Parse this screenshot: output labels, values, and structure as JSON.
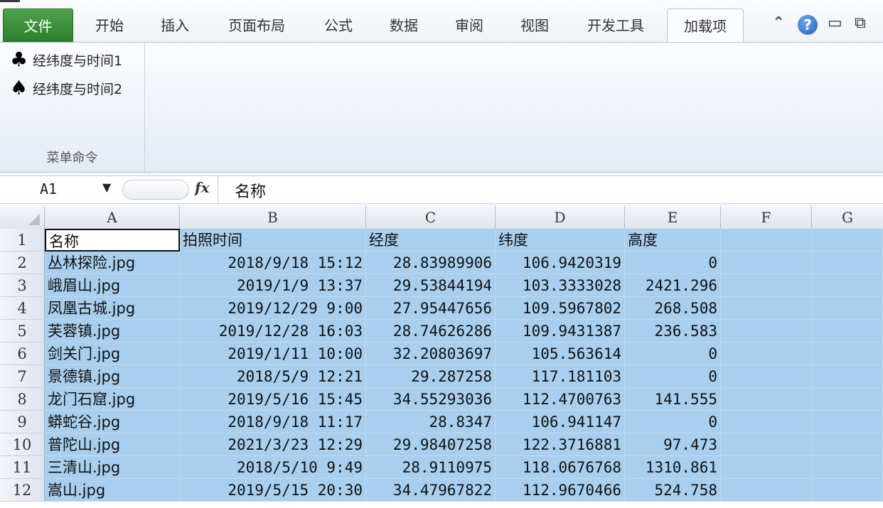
{
  "ribbon": {
    "tabs": [
      "文件",
      "开始",
      "插入",
      "页面布局",
      "公式",
      "数据",
      "审阅",
      "视图",
      "开发工具",
      "加载项"
    ],
    "active_tab": "加载项",
    "window_controls": {
      "collapse": "⌃",
      "help": "?",
      "minimize": "▭",
      "restore": "⧉"
    },
    "menu_group": {
      "items": [
        {
          "icon": "club-icon",
          "glyph": "♣",
          "label": "经纬度与时间1"
        },
        {
          "icon": "spade-icon",
          "glyph": "♠",
          "label": "经纬度与时间2"
        }
      ],
      "label": "菜单命令"
    }
  },
  "formula_bar": {
    "name_box": "A1",
    "fx_label": "fx",
    "content": "名称"
  },
  "sheet": {
    "columns": [
      "A",
      "B",
      "C",
      "D",
      "E",
      "F",
      "G"
    ],
    "row_numbers": [
      "1",
      "2",
      "3",
      "4",
      "5",
      "6",
      "7",
      "8",
      "9",
      "10",
      "11",
      "12"
    ],
    "header": [
      "名称",
      "拍照时间",
      "经度",
      "纬度",
      "高度"
    ],
    "rows": [
      [
        "丛林探险.jpg",
        "2018/9/18 15:12",
        "28.83989906",
        "106.9420319",
        "0"
      ],
      [
        "峨眉山.jpg",
        "2019/1/9 13:37",
        "29.53844194",
        "103.3333028",
        "2421.296"
      ],
      [
        "凤凰古城.jpg",
        "2019/12/29 9:00",
        "27.95447656",
        "109.5967802",
        "268.508"
      ],
      [
        "芙蓉镇.jpg",
        "2019/12/28 16:03",
        "28.74626286",
        "109.9431387",
        "236.583"
      ],
      [
        "剑关门.jpg",
        "2019/1/11 10:00",
        "32.20803697",
        "105.563614",
        "0"
      ],
      [
        "景德镇.jpg",
        "2018/5/9 12:21",
        "29.287258",
        "117.181103",
        "0"
      ],
      [
        "龙门石窟.jpg",
        "2019/5/16 15:45",
        "34.55293036",
        "112.4700763",
        "141.555"
      ],
      [
        "蟒蛇谷.jpg",
        "2018/9/18 11:17",
        "28.8347",
        "106.941147",
        "0"
      ],
      [
        "普陀山.jpg",
        "2021/3/23 12:29",
        "29.98407258",
        "122.3716881",
        "97.473"
      ],
      [
        "三清山.jpg",
        "2018/5/10 9:49",
        "28.9110975",
        "118.0676768",
        "1310.861"
      ],
      [
        "嵩山.jpg",
        "2019/5/15 20:30",
        "34.47967822",
        "112.9670466",
        "524.758"
      ]
    ]
  }
}
